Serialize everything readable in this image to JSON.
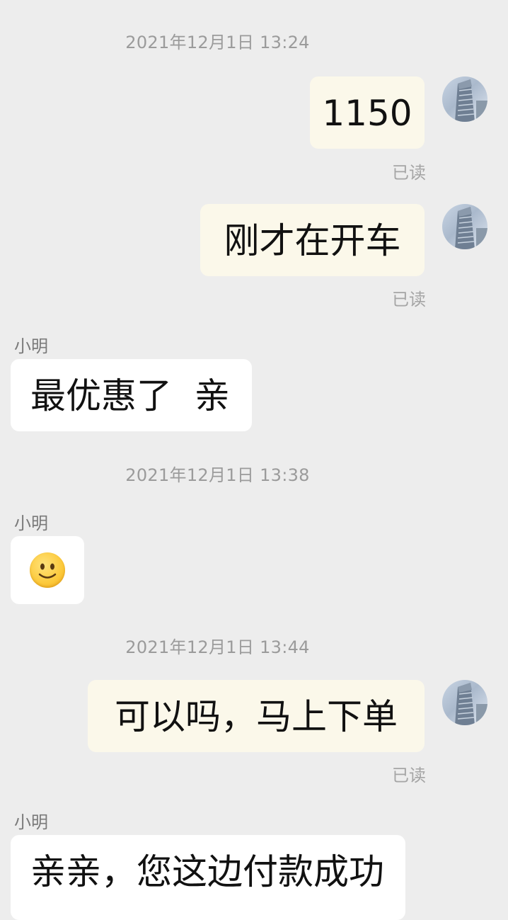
{
  "chat": {
    "timestamps": [
      "2021年12月1日 13:24",
      "2021年12月1日 13:38",
      "2021年12月1日 13:44"
    ],
    "read_label": "已读",
    "sender_name": "小明",
    "messages": [
      {
        "from": "me",
        "text": "1150"
      },
      {
        "from": "me",
        "text": "刚才在开车"
      },
      {
        "from": "other",
        "text": "最优惠了  亲"
      },
      {
        "from": "other",
        "emoji": "slightly-smiling-face-icon"
      },
      {
        "from": "me",
        "text": "可以吗，马上下单"
      },
      {
        "from": "other",
        "text": "亲亲，您这边付款成功"
      }
    ]
  },
  "colors": {
    "background": "#ededed",
    "my_bubble": "#fbf8ea",
    "their_bubble": "#ffffff",
    "meta_text": "#9b9b9b"
  }
}
